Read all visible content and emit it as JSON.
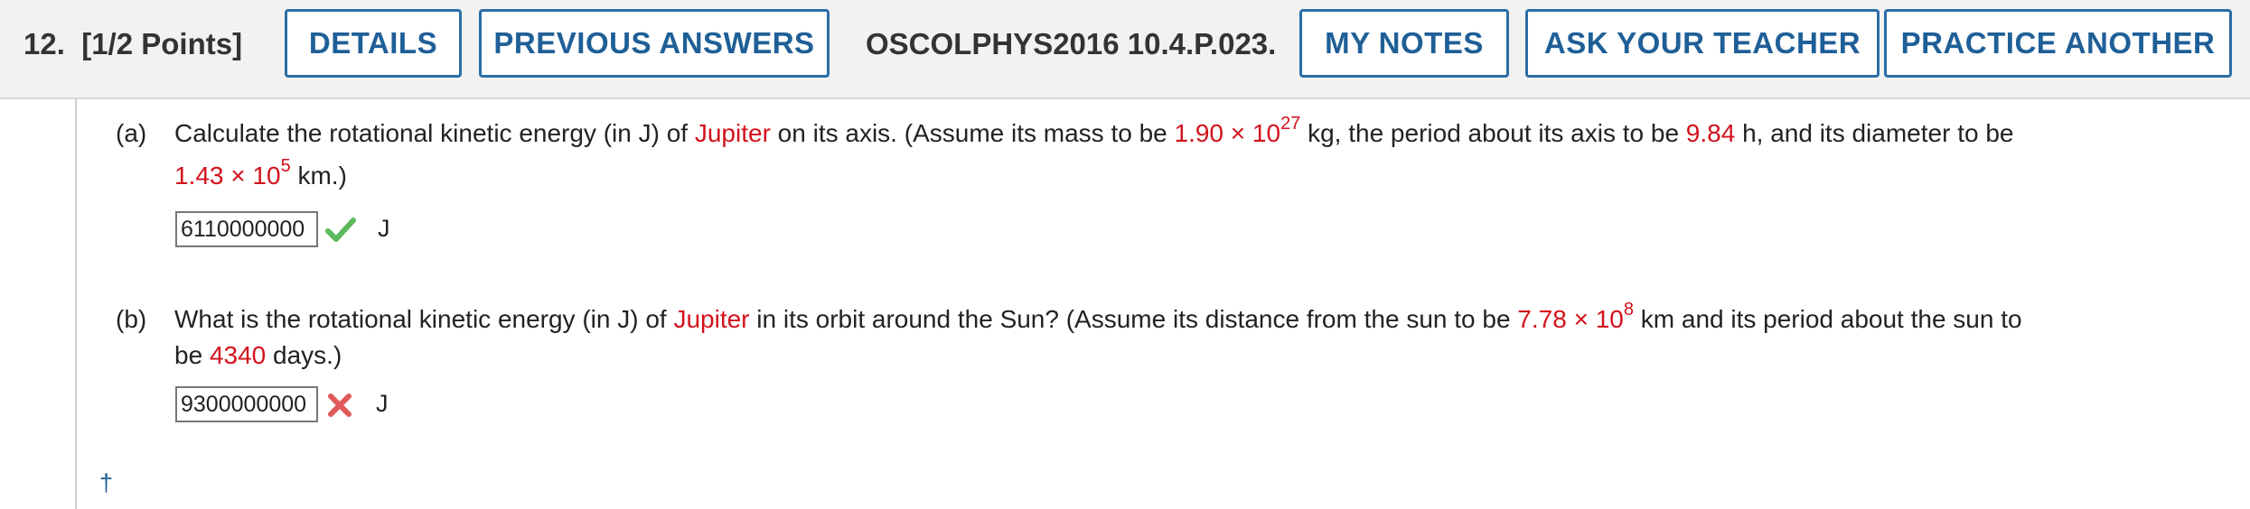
{
  "header": {
    "question_number": "12.",
    "points": "[1/2 Points]",
    "details_label": "DETAILS",
    "previous_answers_label": "PREVIOUS ANSWERS",
    "problem_code": "OSCOLPHYS2016 10.4.P.023.",
    "my_notes_label": "MY NOTES",
    "ask_teacher_label": "ASK YOUR TEACHER",
    "practice_another_label": "PRACTICE ANOTHER"
  },
  "part_a": {
    "label": "(a)",
    "t1": "Calculate the rotational kinetic energy (in J) of ",
    "planet": "Jupiter",
    "t2": " on its axis. (Assume its mass to be ",
    "mass_base": "1.90 × 10",
    "mass_exp": "27",
    "t3": " kg, the period about its axis to be ",
    "period": "9.84",
    "t4": " h, and its diameter to be",
    "diam_base": "1.43 × 10",
    "diam_exp": "5",
    "t5": " km.)",
    "answer": "6110000000",
    "unit": "J",
    "status": "correct"
  },
  "part_b": {
    "label": "(b)",
    "t1": "What is the rotational kinetic energy (in J) of ",
    "planet": "Jupiter",
    "t2": " in its orbit around the Sun? (Assume its distance from the sun to be ",
    "dist_base": "7.78 × 10",
    "dist_exp": "8",
    "t3": " km and its period about the sun to",
    "t4": "be ",
    "period": "4340",
    "t5": " days.)",
    "answer": "9300000000",
    "unit": "J",
    "status": "incorrect"
  },
  "footer": {
    "dagger": "†"
  },
  "colors": {
    "accent": "#2b6ea7",
    "given_value": "#d3121c",
    "correct": "#5cb85c",
    "incorrect": "#e05a5a"
  }
}
